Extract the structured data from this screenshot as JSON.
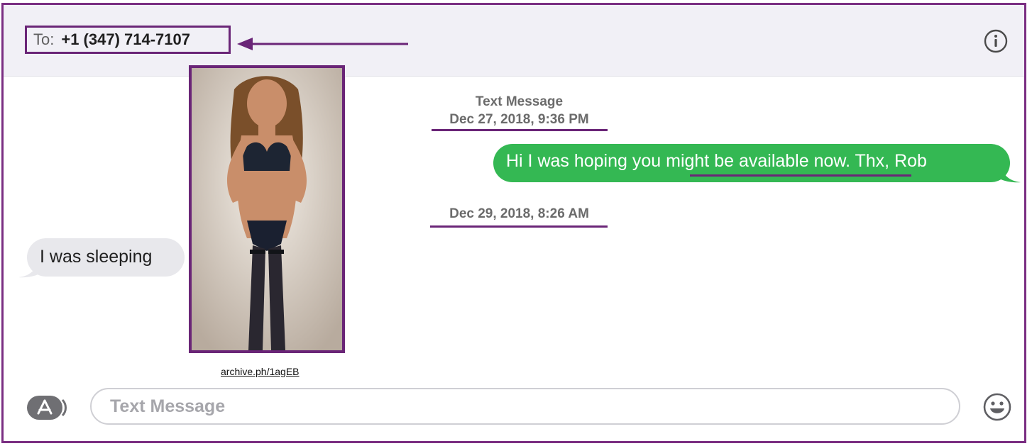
{
  "header": {
    "to_label": "To:",
    "recipient": "+1 (347) 714-7107",
    "info_icon": "info-circle-icon"
  },
  "thread": {
    "service_label": "Text Message",
    "timestamp_1": "Dec 27, 2018, 9:36 PM",
    "outgoing_message": {
      "before": "Hi I was hoping you ",
      "highlight": "might be available now.",
      "after": " Thx, Rob"
    },
    "timestamp_2": "Dec 29, 2018, 8:26 AM",
    "incoming_message": "I was sleeping"
  },
  "attachment": {
    "source_link": "archive.ph/1agEB"
  },
  "composer": {
    "placeholder": "Text Message",
    "apps_icon": "app-store-icon",
    "emoji_icon": "emoji-smiley-icon"
  },
  "colors": {
    "annotation": "#6a2577",
    "sent_bubble": "#34b853",
    "received_bubble": "#e8e8ec"
  }
}
